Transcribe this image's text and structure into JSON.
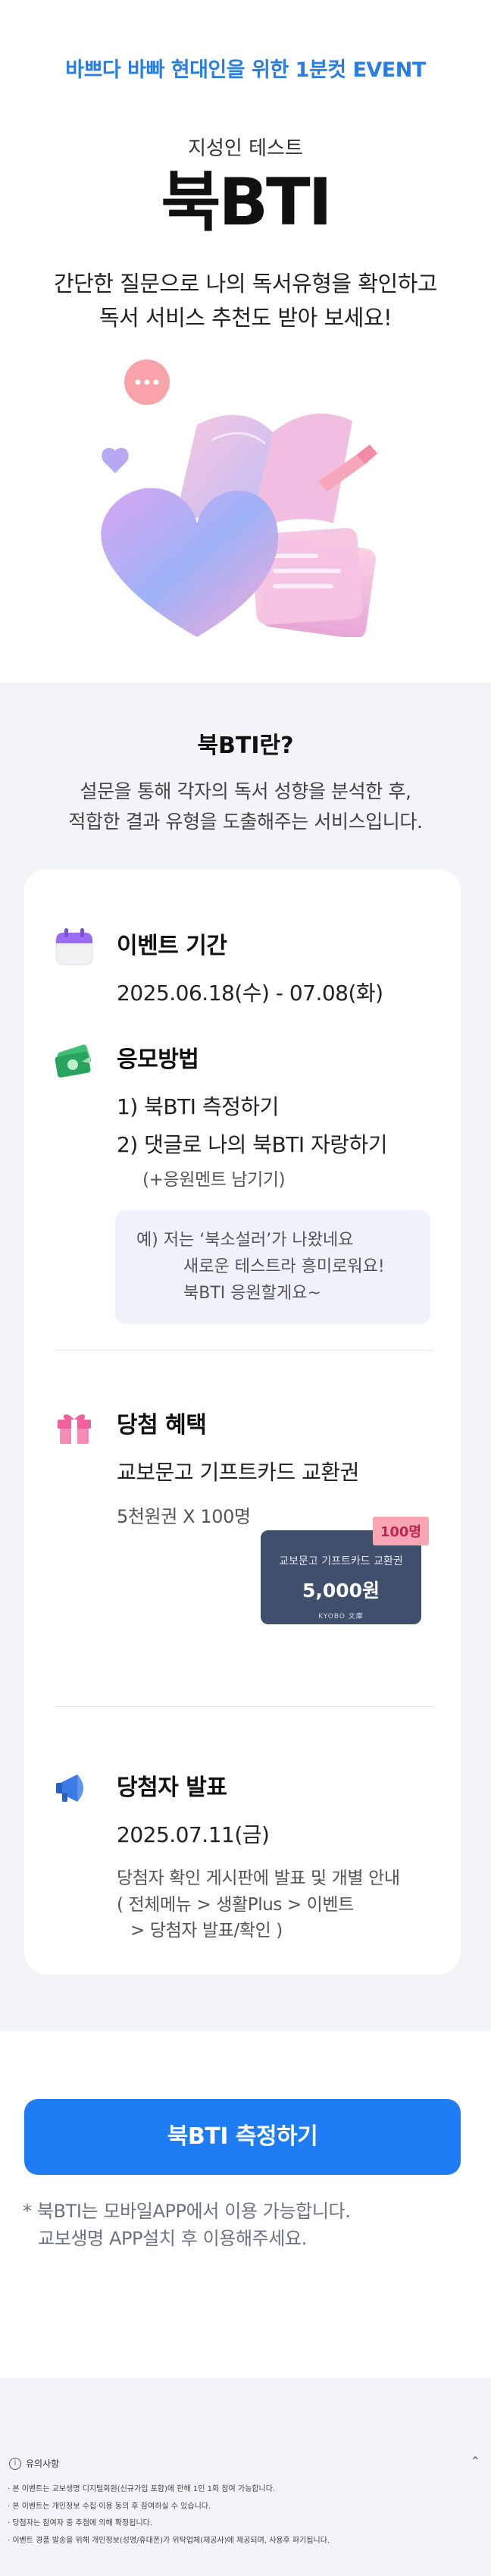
{
  "hero": {
    "event_tag": "바쁘다 바빠 현대인을 위한 1분컷 EVENT",
    "subtitle": "지성인 테스트",
    "title": "북BTI",
    "desc_line1": "간단한 질문으로 나의 독서유형을 확인하고",
    "desc_line2": "독서 서비스 추천도 받아 보세요!"
  },
  "about": {
    "title": "북BTI란?",
    "desc_line1": "설문을 통해 각자의 독서 성향을 분석한 후,",
    "desc_line2": "적합한 결과 유형을 도출해주는 서비스입니다."
  },
  "period": {
    "title": "이벤트 기간",
    "value": "2025.06.18(수) - 07.08(화)"
  },
  "method": {
    "title": "응모방법",
    "step1": "1) 북BTI 측정하기",
    "step2": "2) 댓글로 나의 북BTI 자랑하기",
    "step2_note": "(+응원멘트 남기기)",
    "example_line1": "예) 저는 ‘북소설러’가 나왔네요",
    "example_line2": "새로운 테스트라 흥미로워요!",
    "example_line3": "북BTI 응원할게요~"
  },
  "prize": {
    "title": "당첨 혜택",
    "item": "교보문고 기프트카드 교환권",
    "count": "5천원권 X 100명",
    "card_badge": "100명",
    "card_label": "교보문고 기프트카드 교환권",
    "card_amount": "5,000원",
    "card_logo": "KYOBO 文庫"
  },
  "announce": {
    "title": "당첨자 발표",
    "date": "2025.07.11(금)",
    "line1": "당첨자 확인 게시판에 발표 및 개별 안내",
    "line2": "( 전체메뉴 > 생활Plus > 이벤트",
    "line3": "> 당첨자 발표/확인 )"
  },
  "cta": {
    "button": "북BTI 측정하기",
    "note_line1": "* 북BTI는 모바일APP에서 이용 가능합니다.",
    "note_line2": "교보생명 APP설치 후 이용해주세요."
  },
  "notice": {
    "title": "유의사항",
    "items": [
      "· 본 이벤트는 교보생명 디지털회원(신규가입 포함)에 한해 1인 1회 참여 가능합니다.",
      "· 본 이벤트는 개인정보 수집·이용 동의 후 참여하실 수 있습니다.",
      "· 당첨자는 참여자 중 추첨에 의해 확정됩니다.",
      "· 이벤트 경품 발송을 위해 개인정보(성명/휴대폰)가 위탁업체(제공사)에 제공되며, 사용후 파기됩니다."
    ]
  },
  "colors": {
    "accent": "#1e7cf5",
    "event_tag": "#2a7de1",
    "section_bg": "#f3f4f7",
    "gift_card": "#3f4f6c",
    "badge": "#f9a6b4"
  },
  "icons": {
    "period": "calendar-icon",
    "method": "money-envelope-icon",
    "prize": "gift-box-icon",
    "announce": "megaphone-icon",
    "notice": "info-icon",
    "notice_toggle": "chevron-up-icon"
  }
}
